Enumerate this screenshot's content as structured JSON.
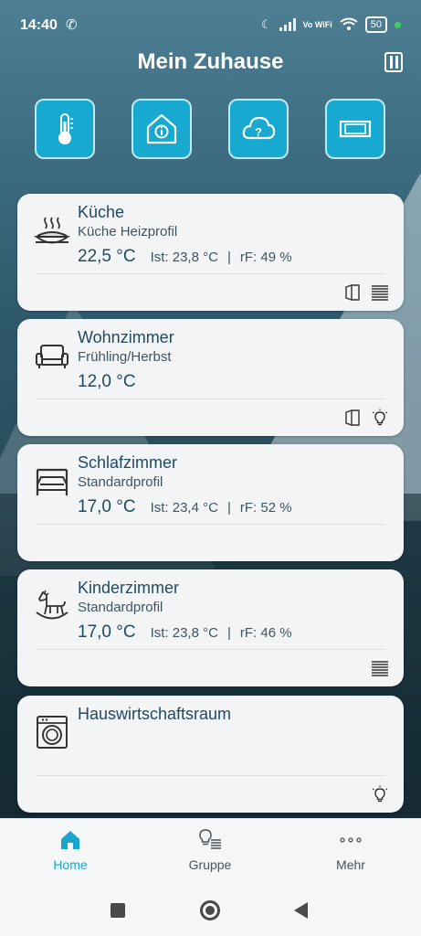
{
  "status_bar": {
    "time": "14:40",
    "network": "Vo WiFi",
    "battery": "50"
  },
  "header": {
    "title": "Mein Zuhause"
  },
  "quick_actions": [
    {
      "icon": "thermometer-icon"
    },
    {
      "icon": "house-info-icon"
    },
    {
      "icon": "cloud-question-icon"
    },
    {
      "icon": "window-icon"
    }
  ],
  "rooms": [
    {
      "name": "Küche",
      "profile": "Küche Heizprofil",
      "setpoint": "22,5 °C",
      "ist": "Ist: 23,8 °C",
      "sep": "|",
      "rf": "rF: 49 %",
      "icon": "food-bowl-icon",
      "actions": [
        "window-open-icon",
        "radiator-icon"
      ]
    },
    {
      "name": "Wohnzimmer",
      "profile": "Frühling/Herbst",
      "setpoint": "12,0 °C",
      "ist": "",
      "sep": "",
      "rf": "",
      "icon": "sofa-icon",
      "actions": [
        "window-open-icon",
        "light-bulb-icon"
      ]
    },
    {
      "name": "Schlafzimmer",
      "profile": "Standardprofil",
      "setpoint": "17,0 °C",
      "ist": "Ist: 23,4 °C",
      "sep": "|",
      "rf": "rF: 52 %",
      "icon": "bed-icon",
      "actions": []
    },
    {
      "name": "Kinderzimmer",
      "profile": "Standardprofil",
      "setpoint": "17,0 °C",
      "ist": "Ist: 23,8 °C",
      "sep": "|",
      "rf": "rF: 46 %",
      "icon": "rocking-horse-icon",
      "actions": [
        "radiator-icon"
      ]
    },
    {
      "name": "Hauswirtschaftsraum",
      "profile": "",
      "setpoint": "",
      "ist": "",
      "sep": "",
      "rf": "",
      "icon": "washing-machine-icon",
      "actions": [
        "light-bulb-icon"
      ]
    }
  ],
  "bottom_nav": [
    {
      "label": "Home",
      "icon": "home-icon",
      "active": true
    },
    {
      "label": "Gruppe",
      "icon": "group-icon",
      "active": false
    },
    {
      "label": "Mehr",
      "icon": "more-dots-icon",
      "active": false
    }
  ],
  "colors": {
    "accent": "#1aa6cc",
    "card_bg": "#f3f4f5",
    "text_primary": "#1f4a62"
  }
}
